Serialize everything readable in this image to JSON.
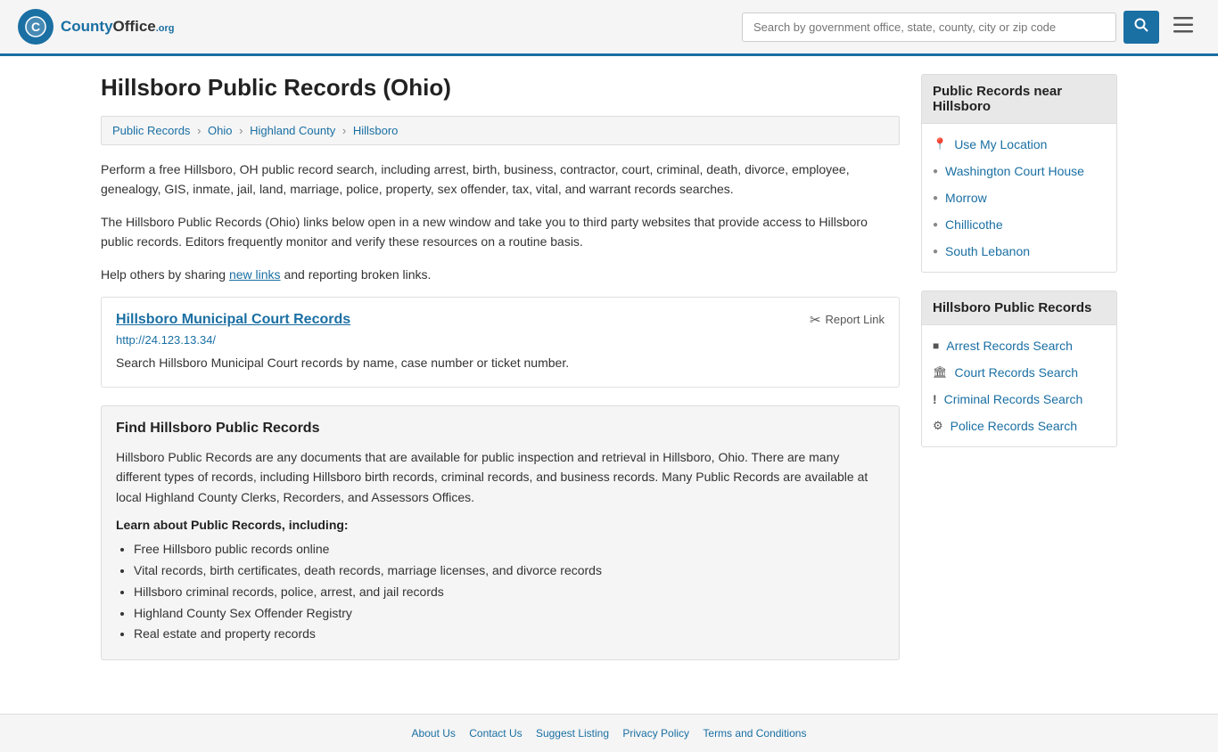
{
  "header": {
    "logo_text": "CountyOffice",
    "logo_org": ".org",
    "search_placeholder": "Search by government office, state, county, city or zip code",
    "search_button_label": "🔍"
  },
  "page": {
    "title": "Hillsboro Public Records (Ohio)",
    "breadcrumbs": [
      {
        "label": "Public Records",
        "href": "#"
      },
      {
        "label": "Ohio",
        "href": "#"
      },
      {
        "label": "Highland County",
        "href": "#"
      },
      {
        "label": "Hillsboro",
        "href": "#"
      }
    ],
    "description1": "Perform a free Hillsboro, OH public record search, including arrest, birth, business, contractor, court, criminal, death, divorce, employee, genealogy, GIS, inmate, jail, land, marriage, police, property, sex offender, tax, vital, and warrant records searches.",
    "description2": "The Hillsboro Public Records (Ohio) links below open in a new window and take you to third party websites that provide access to Hillsboro public records. Editors frequently monitor and verify these resources on a routine basis.",
    "description3_pre": "Help others by sharing ",
    "description3_link": "new links",
    "description3_post": " and reporting broken links.",
    "record_card": {
      "title": "Hillsboro Municipal Court Records",
      "report_label": "Report Link",
      "url": "http://24.123.13.34/",
      "description": "Search Hillsboro Municipal Court records by name, case number or ticket number."
    },
    "find_section": {
      "title": "Find Hillsboro Public Records",
      "text": "Hillsboro Public Records are any documents that are available for public inspection and retrieval in Hillsboro, Ohio. There are many different types of records, including Hillsboro birth records, criminal records, and business records. Many Public Records are available at local Highland County Clerks, Recorders, and Assessors Offices.",
      "subtitle": "Learn about Public Records, including:",
      "bullets": [
        "Free Hillsboro public records online",
        "Vital records, birth certificates, death records, marriage licenses, and divorce records",
        "Hillsboro criminal records, police, arrest, and jail records",
        "Highland County Sex Offender Registry",
        "Real estate and property records"
      ]
    }
  },
  "sidebar": {
    "nearby_title": "Public Records near Hillsboro",
    "nearby_items": [
      {
        "label": "Use My Location",
        "icon": "location"
      },
      {
        "label": "Washington Court House",
        "icon": "link"
      },
      {
        "label": "Morrow",
        "icon": "link"
      },
      {
        "label": "Chillicothe",
        "icon": "link"
      },
      {
        "label": "South Lebanon",
        "icon": "link"
      }
    ],
    "records_title": "Hillsboro Public Records",
    "records_items": [
      {
        "label": "Arrest Records Search",
        "icon": "square"
      },
      {
        "label": "Court Records Search",
        "icon": "building"
      },
      {
        "label": "Criminal Records Search",
        "icon": "exclamation"
      },
      {
        "label": "Police Records Search",
        "icon": "gear"
      }
    ]
  },
  "footer": {
    "links": [
      "About Us",
      "Contact Us",
      "Suggest Listing",
      "Privacy Policy",
      "Terms and Conditions"
    ]
  }
}
